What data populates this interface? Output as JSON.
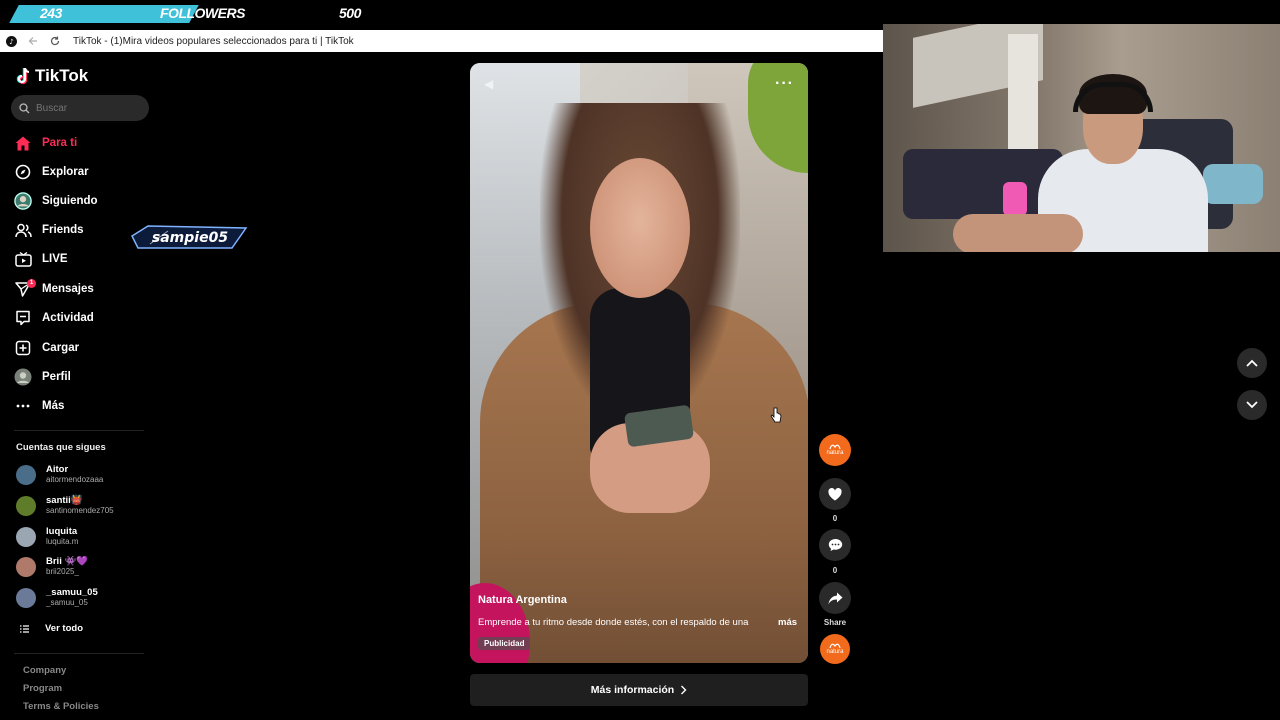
{
  "overlay": {
    "followers_current": "243",
    "followers_label": "FOLLOWERS",
    "followers_goal": "500",
    "progress": 0.486,
    "accent": "#3fc1d9"
  },
  "browser": {
    "tab_title": "TikTok - (1)Mira videos populares seleccionados para ti | TikTok"
  },
  "sidebar": {
    "logo_text": "TikTok",
    "search_placeholder": "Buscar",
    "nav": [
      {
        "label": "Para ti",
        "icon": "home-icon",
        "active": true
      },
      {
        "label": "Explorar",
        "icon": "compass-icon"
      },
      {
        "label": "Siguiendo",
        "icon": "avatar-icon"
      },
      {
        "label": "Friends",
        "icon": "friends-icon"
      },
      {
        "label": "LIVE",
        "icon": "live-icon"
      },
      {
        "label": "Mensajes",
        "icon": "send-icon",
        "badge": "1"
      },
      {
        "label": "Actividad",
        "icon": "activity-icon"
      },
      {
        "label": "Cargar",
        "icon": "upload-icon"
      },
      {
        "label": "Perfil",
        "icon": "profile-avatar-icon"
      },
      {
        "label": "Más",
        "icon": "more-dots-icon"
      }
    ],
    "following_title": "Cuentas que sigues",
    "accounts": [
      {
        "name": "Aitor",
        "handle": "aitormendozaaa"
      },
      {
        "name": "santii👹",
        "handle": "santinomendez705"
      },
      {
        "name": "luquita",
        "handle": "luquita.m"
      },
      {
        "name": "Brii 👾💜",
        "handle": "brii2025_"
      },
      {
        "name": "_samuu_05",
        "handle": "_samuu_05"
      }
    ],
    "see_all": "Ver todo",
    "footer": [
      "Company",
      "Program",
      "Terms & Policies"
    ]
  },
  "watermark": {
    "text": "sampie05"
  },
  "video": {
    "author": "Natura Argentina",
    "description": "Emprende a tu ritmo desde donde estés, con el respaldo de una",
    "more": "más",
    "tag": "Publicidad",
    "cta": "Más información"
  },
  "actions": {
    "brand_text": "natura",
    "likes": "0",
    "comments": "0",
    "share": "Share",
    "brand_color": "#f26a1b"
  }
}
